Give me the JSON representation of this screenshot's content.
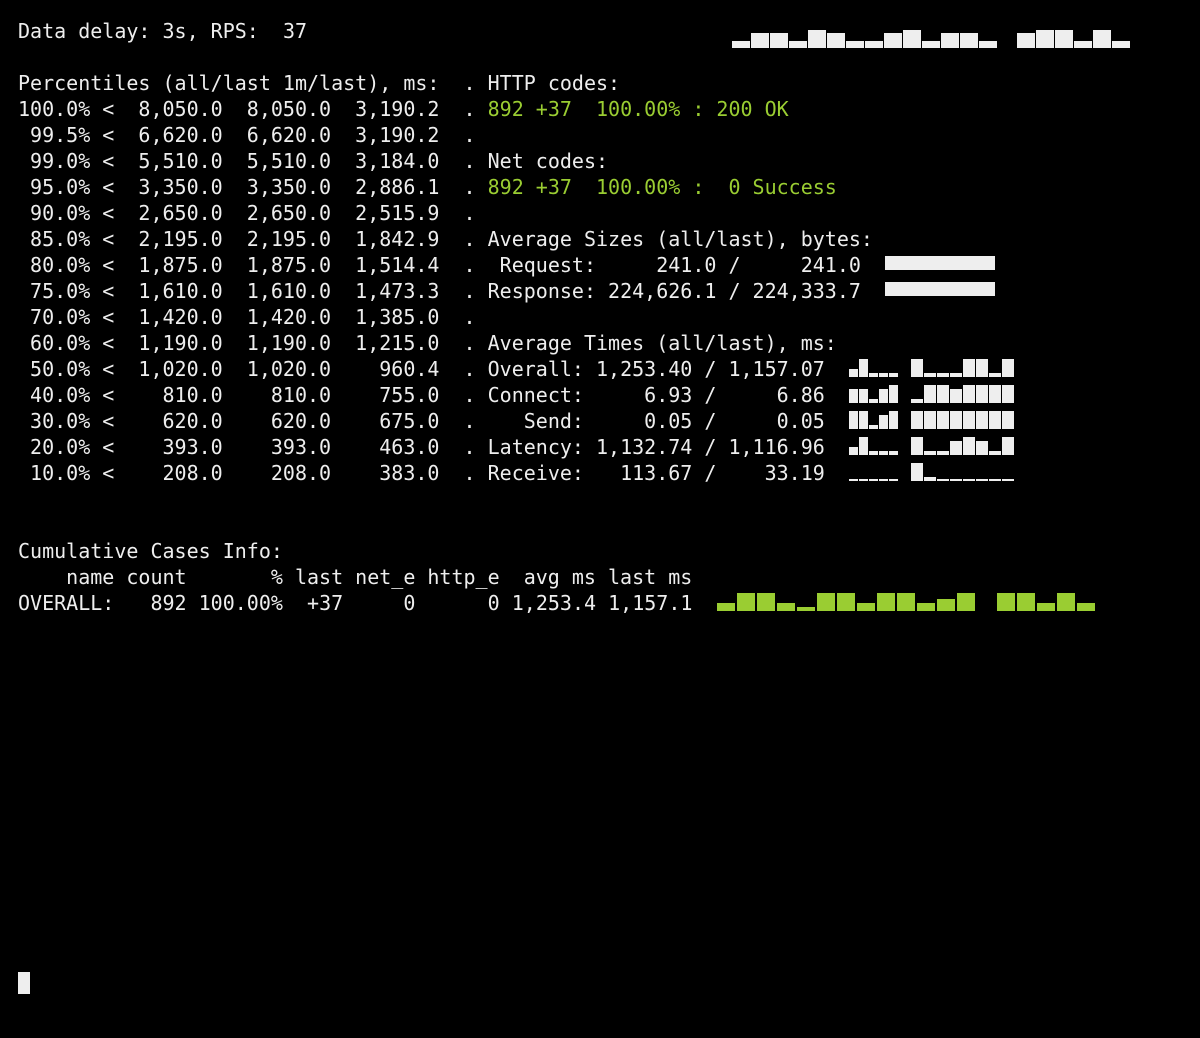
{
  "header": {
    "delay_label": "Data delay:",
    "delay_value": "3s,",
    "rps_label": "RPS:",
    "rps_value": "37"
  },
  "header_spark": [
    7,
    15,
    15,
    7,
    18,
    15,
    7,
    7,
    15,
    18,
    7,
    15,
    15,
    7,
    0,
    15,
    18,
    18,
    7,
    18,
    7
  ],
  "percentiles": {
    "title": "Percentiles (all/last 1m/last), ms:",
    "rows": [
      {
        "pct": "100.0% <",
        "all": " 8,050.0",
        "m1": " 8,050.0",
        "last": " 3,190.2"
      },
      {
        "pct": " 99.5% <",
        "all": " 6,620.0",
        "m1": " 6,620.0",
        "last": " 3,190.2"
      },
      {
        "pct": " 99.0% <",
        "all": " 5,510.0",
        "m1": " 5,510.0",
        "last": " 3,184.0"
      },
      {
        "pct": " 95.0% <",
        "all": " 3,350.0",
        "m1": " 3,350.0",
        "last": " 2,886.1"
      },
      {
        "pct": " 90.0% <",
        "all": " 2,650.0",
        "m1": " 2,650.0",
        "last": " 2,515.9"
      },
      {
        "pct": " 85.0% <",
        "all": " 2,195.0",
        "m1": " 2,195.0",
        "last": " 1,842.9"
      },
      {
        "pct": " 80.0% <",
        "all": " 1,875.0",
        "m1": " 1,875.0",
        "last": " 1,514.4"
      },
      {
        "pct": " 75.0% <",
        "all": " 1,610.0",
        "m1": " 1,610.0",
        "last": " 1,473.3"
      },
      {
        "pct": " 70.0% <",
        "all": " 1,420.0",
        "m1": " 1,420.0",
        "last": " 1,385.0"
      },
      {
        "pct": " 60.0% <",
        "all": " 1,190.0",
        "m1": " 1,190.0",
        "last": " 1,215.0"
      },
      {
        "pct": " 50.0% <",
        "all": " 1,020.0",
        "m1": " 1,020.0",
        "last": "   960.4"
      },
      {
        "pct": " 40.0% <",
        "all": "   810.0",
        "m1": "   810.0",
        "last": "   755.0"
      },
      {
        "pct": " 30.0% <",
        "all": "   620.0",
        "m1": "   620.0",
        "last": "   675.0"
      },
      {
        "pct": " 20.0% <",
        "all": "   393.0",
        "m1": "   393.0",
        "last": "   463.0"
      },
      {
        "pct": " 10.0% <",
        "all": "   208.0",
        "m1": "   208.0",
        "last": "   383.0"
      }
    ]
  },
  "dot": ".",
  "http": {
    "title": "HTTP codes:",
    "line": "892 +37  100.00% : 200 OK"
  },
  "net": {
    "title": "Net codes:",
    "line": "892 +37  100.00% :  0 Success"
  },
  "sizes": {
    "title": "Average Sizes (all/last), bytes:",
    "req": " Request:     241.0 /     241.0",
    "resp": "Response: 224,626.1 / 224,333.7"
  },
  "times": {
    "title": "Average Times (all/last), ms:",
    "rows": [
      {
        "label": "Overall:",
        "all": "1,253.40",
        "last": "1,157.07",
        "spark_a": [
          8,
          18,
          4,
          4,
          4
        ],
        "spark_b": [
          18,
          4,
          4,
          4,
          18,
          18,
          4,
          18
        ]
      },
      {
        "label": "Connect:",
        "all": "    6.93",
        "last": "    6.86",
        "spark_a": [
          14,
          14,
          4,
          14,
          18
        ],
        "spark_b": [
          4,
          18,
          18,
          14,
          18,
          18,
          18,
          18
        ]
      },
      {
        "label": "   Send:",
        "all": "    0.05",
        "last": "    0.05",
        "spark_a": [
          18,
          18,
          4,
          14,
          18
        ],
        "spark_b": [
          18,
          18,
          18,
          18,
          18,
          18,
          18,
          18
        ]
      },
      {
        "label": "Latency:",
        "all": "1,132.74",
        "last": "1,116.96",
        "spark_a": [
          8,
          18,
          4,
          4,
          4
        ],
        "spark_b": [
          18,
          4,
          4,
          14,
          18,
          14,
          4,
          18
        ]
      },
      {
        "label": "Receive:",
        "all": "  113.67",
        "last": "   33.19",
        "spark_a": [
          2,
          2,
          2,
          2,
          2
        ],
        "spark_b": [
          18,
          4,
          2,
          2,
          2,
          2,
          2,
          2
        ]
      }
    ]
  },
  "cases": {
    "title": "Cumulative Cases Info:",
    "header": "    name count       % last net_e http_e  avg ms last ms",
    "row": {
      "name": "OVERALL:",
      "count": "  892",
      "pct": "100.00%",
      "last": " +37",
      "nete": "    0",
      "httpe": "     0",
      "avgms": "1,253.4",
      "lastms": "1,157.1"
    },
    "spark": [
      8,
      18,
      18,
      8,
      4,
      18,
      18,
      8,
      18,
      18,
      8,
      12,
      18,
      0,
      18,
      18,
      8,
      18,
      8
    ]
  },
  "colors": {
    "green": "#9acd32"
  }
}
